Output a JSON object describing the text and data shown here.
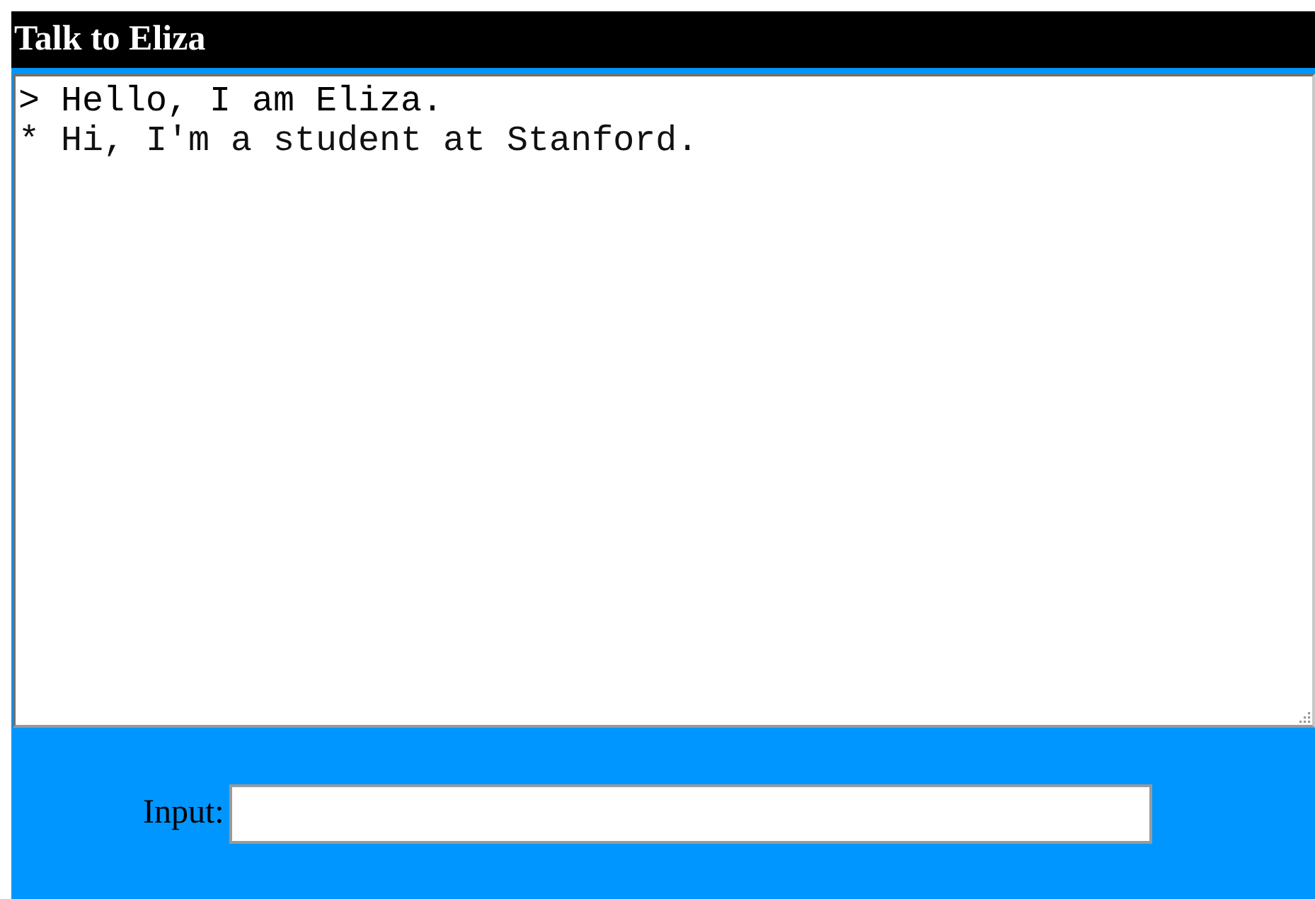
{
  "window": {
    "title": "Talk to Eliza"
  },
  "transcript": {
    "lines": [
      {
        "kind": "eliza",
        "marker": ">",
        "text": "Hello, I am Eliza."
      },
      {
        "kind": "user",
        "marker": "*",
        "text": "Hi, I'm a student at Stanford."
      }
    ]
  },
  "input": {
    "label": "Input:"
  }
}
